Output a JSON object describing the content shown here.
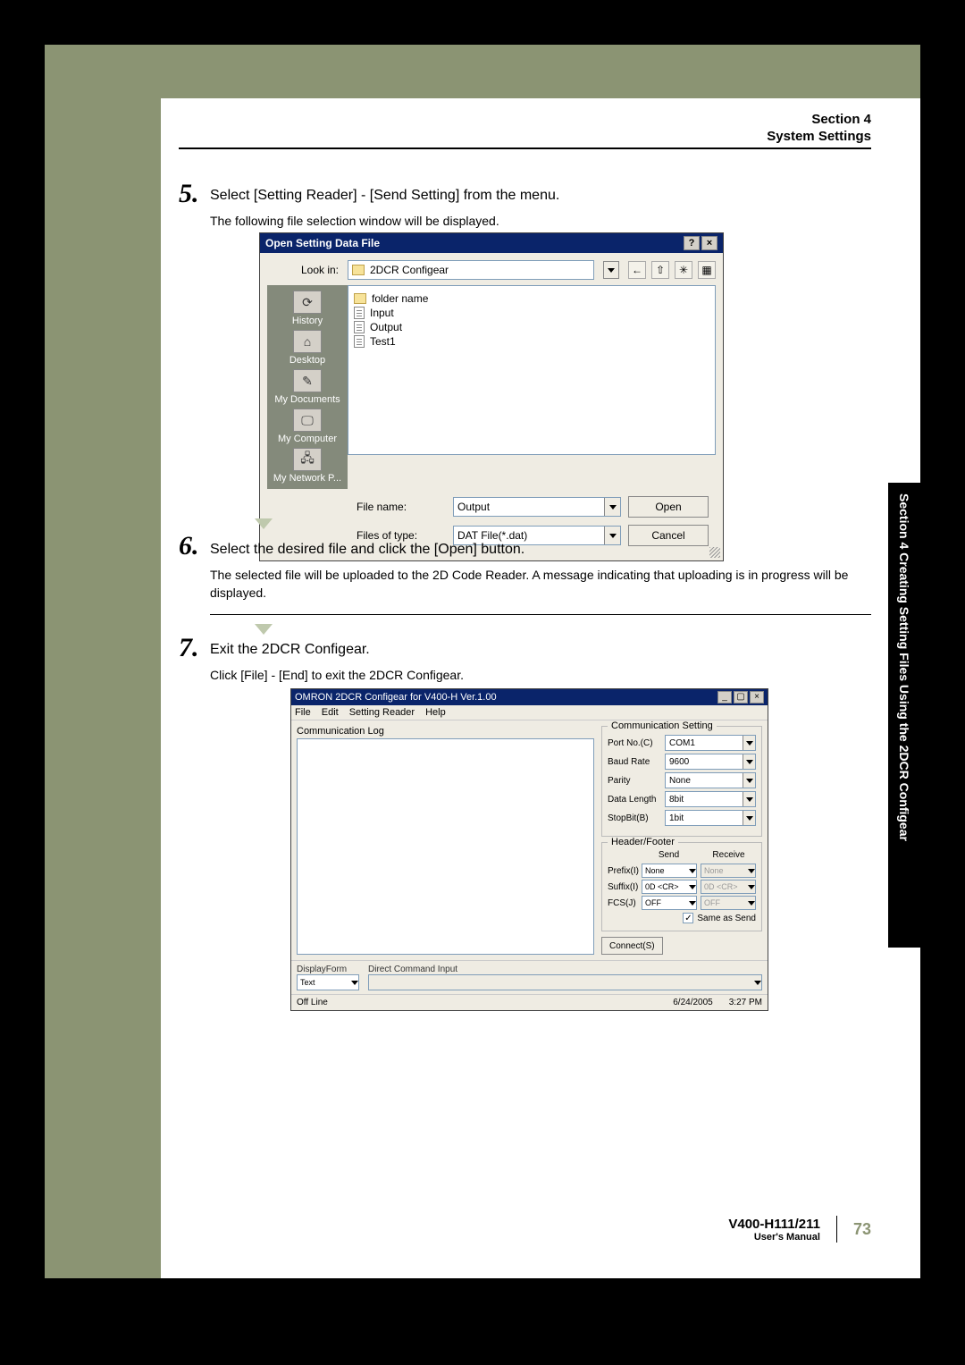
{
  "header": {
    "section": "Section 4",
    "title": "System Settings"
  },
  "sidetab": "Section 4   Creating Setting Files Using the 2DCR Configear",
  "step5": {
    "num": "5.",
    "title": "Select [Setting Reader] - [Send Setting] from the menu.",
    "sub": "The following file selection window will be displayed."
  },
  "dlg1": {
    "title": "Open Setting Data File",
    "help_btn": "?",
    "close_btn": "×",
    "lookin_label": "Look in:",
    "lookin_value": "2DCR Configear",
    "nav": {
      "back": "←",
      "up": "⇧",
      "newfolder": "✳",
      "views": "▦"
    },
    "places": [
      {
        "icon": "⟳",
        "label": "History"
      },
      {
        "icon": "⌂",
        "label": "Desktop"
      },
      {
        "icon": "✎",
        "label": "My Documents"
      },
      {
        "icon": "🖵",
        "label": "My Computer"
      },
      {
        "icon": "🖧",
        "label": "My Network P..."
      }
    ],
    "files": [
      {
        "type": "folder",
        "name": "folder name"
      },
      {
        "type": "file",
        "name": "Input"
      },
      {
        "type": "file",
        "name": "Output"
      },
      {
        "type": "file",
        "name": "Test1"
      }
    ],
    "filename_label": "File name:",
    "filename_value": "Output",
    "filetype_label": "Files of type:",
    "filetype_value": "DAT File(*.dat)",
    "open_btn": "Open",
    "cancel_btn": "Cancel"
  },
  "step6": {
    "num": "6.",
    "title": "Select the desired file and click the [Open] button.",
    "sub": "The selected file will be uploaded to the 2D Code Reader. A message indicating that uploading is in progress will be displayed."
  },
  "step7": {
    "num": "7.",
    "title": "Exit the 2DCR  Configear.",
    "sub": "Click [File] - [End] to exit the 2DCR Configear."
  },
  "dlg2": {
    "title": "OMRON 2DCR Configear for V400-H Ver.1.00",
    "min": "_",
    "max": "▢",
    "close": "×",
    "menu": [
      "File",
      "Edit",
      "Setting Reader",
      "Help"
    ],
    "commlog_label": "Communication Log",
    "comm_setting": {
      "legend": "Communication Setting",
      "rows": [
        {
          "label": "Port No.(C)",
          "value": "COM1"
        },
        {
          "label": "Baud Rate",
          "value": "9600"
        },
        {
          "label": "Parity",
          "value": "None"
        },
        {
          "label": "Data Length",
          "value": "8bit"
        },
        {
          "label": "StopBit(B)",
          "value": "1bit"
        }
      ]
    },
    "headerfooter": {
      "legend": "Header/Footer",
      "send": "Send",
      "receive": "Receive",
      "rows": [
        {
          "label": "Prefix(I)",
          "s": "None",
          "r": "None"
        },
        {
          "label": "Suffix(I)",
          "s": "0D <CR>",
          "r": "0D <CR>"
        },
        {
          "label": "FCS(J)",
          "s": "OFF",
          "r": "OFF"
        }
      ],
      "same": "Same as Send"
    },
    "connect": "Connect(S)",
    "displayform_label": "DisplayForm",
    "displayform_value": "Text",
    "direct_command": "Direct Command Input",
    "status_left": "Off Line",
    "status_date": "6/24/2005",
    "status_time": "3:27 PM"
  },
  "footer": {
    "model": "V400-H111/211",
    "manual": "User's Manual",
    "page": "73"
  }
}
